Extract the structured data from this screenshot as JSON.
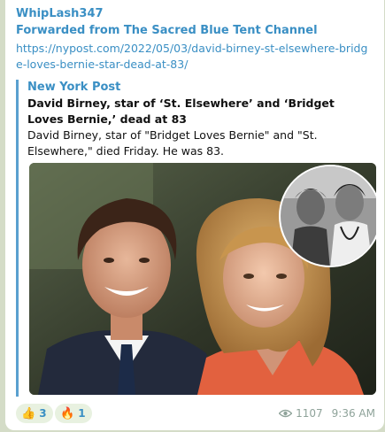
{
  "message": {
    "sender": "WhipLash347",
    "forwarded_from": "Forwarded from The Sacred Blue Tent Channel",
    "link": "https://nypost.com/2022/05/03/david-birney-st-elsewhere-bridge-loves-bernie-star-dead-at-83/"
  },
  "preview": {
    "site_name": "New York Post",
    "title": "David Birney, star of ‘St. Elsewhere’ and ‘Bridget Loves Bernie,’ dead at 83",
    "description": "David Birney, star of \"Bridget Loves Bernie\" and \"St. Elsewhere,\" died Friday. He was 83."
  },
  "reactions": [
    {
      "emoji": "👍",
      "icon": "thumbs-up-icon",
      "count": "3"
    },
    {
      "emoji": "🔥",
      "icon": "fire-icon",
      "count": "1"
    }
  ],
  "meta": {
    "views": "1107",
    "time": "9:36 AM"
  },
  "colors": {
    "background": "#d4dcc7",
    "accent": "#3a8fc4",
    "preview_bar": "#5aa0cf"
  }
}
